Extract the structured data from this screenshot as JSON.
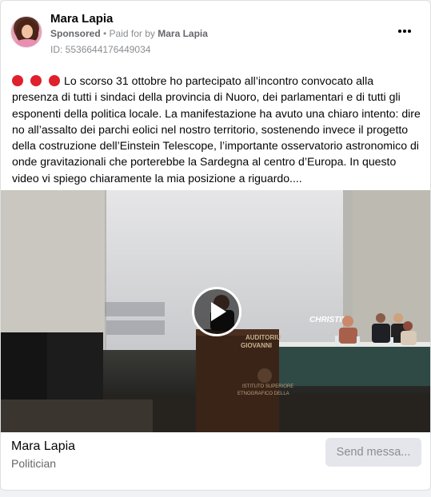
{
  "header": {
    "page_name": "Mara Lapia",
    "sponsored_label": "Sponsored",
    "separator": " • ",
    "paid_for_by_label": "Paid for by ",
    "paid_for_by_name": "Mara Lapia",
    "ad_id": "ID: 5536644176449034",
    "more_icon": "more-horizontal-icon"
  },
  "post": {
    "text": "Lo scorso 31 ottobre ho partecipato all’incontro convocato alla presenza di tutti i sindaci della provincia di Nuoro, dei parlamentari e di tutti gli esponenti della politica locale. La manifestazione ha avuto una chiaro intento: dire no all’assalto dei parchi eolici nel nostro territorio, sostenendo invece il progetto della costruzione dell’Einstein Telescope, l’importante osservatorio astronomico di onde gravitazionali che porterebbe la Sardegna al centro d’Europa. In questo video vi spiego chiaramente la mia posizione a riguardo....",
    "emoji_color": "#e0202c"
  },
  "video": {
    "podium_text_line1": "AUDITORIU",
    "podium_text_line2": "GIOVANNI",
    "podium_text_line3": "ISTITUTO SUPERIORE",
    "podium_text_line4": "ETNOGRAFICO DELLA",
    "screen_logo": "CHRISTIE",
    "play_icon": "play-icon"
  },
  "footer": {
    "name": "Mara Lapia",
    "category": "Politician",
    "send_message_label": "Send messa..."
  },
  "colors": {
    "text_primary": "#050505",
    "text_secondary": "#65676b",
    "button_bg": "#e4e6eb"
  }
}
